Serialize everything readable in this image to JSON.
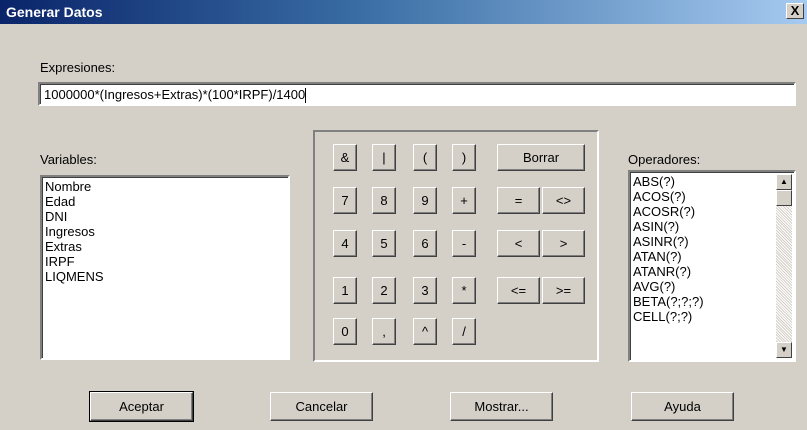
{
  "window": {
    "title": "Generar Datos",
    "close_glyph": "X"
  },
  "expression": {
    "label": "Expresiones:",
    "value": "1000000*(Ingresos+Extras)*(100*IRPF)/1400"
  },
  "variables": {
    "label": "Variables:",
    "items": [
      "Nombre",
      "Edad",
      "DNI",
      "Ingresos",
      "Extras",
      "IRPF",
      "LIQMENS"
    ]
  },
  "operators": {
    "label": "Operadores:",
    "items": [
      "ABS(?)",
      "ACOS(?)",
      "ACOSR(?)",
      "ASIN(?)",
      "ASINR(?)",
      "ATAN(?)",
      "ATANR(?)",
      "AVG(?)",
      "BETA(?;?;?)",
      "CELL(?;?)"
    ],
    "scroll_up": "▲",
    "scroll_down": "▼"
  },
  "keypad": {
    "row1": [
      "&",
      "|",
      "(",
      ")"
    ],
    "borrar": "Borrar",
    "row2": [
      "7",
      "8",
      "9",
      "+"
    ],
    "row2_wide": [
      "=",
      "<>"
    ],
    "row3": [
      "4",
      "5",
      "6",
      "-"
    ],
    "row3_wide": [
      "<",
      ">"
    ],
    "row4": [
      "1",
      "2",
      "3",
      "*"
    ],
    "row4_wide": [
      "<=",
      ">="
    ],
    "row5": [
      "0",
      ",",
      "^",
      "/"
    ]
  },
  "buttons": {
    "aceptar": "Aceptar",
    "cancelar": "Cancelar",
    "mostrar": "Mostrar...",
    "ayuda": "Ayuda"
  }
}
